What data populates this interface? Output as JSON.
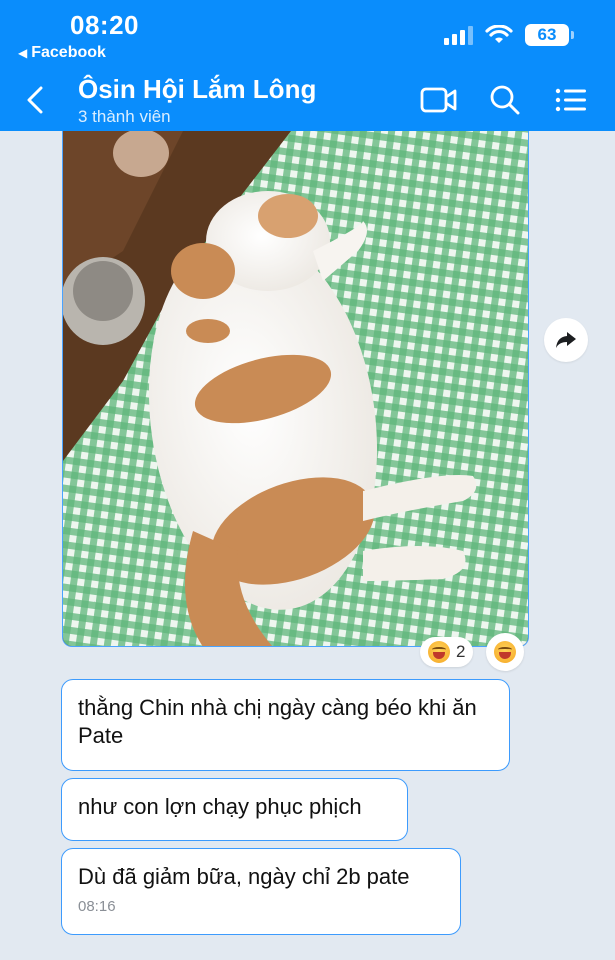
{
  "status_bar": {
    "time": "08:20",
    "back_app": "Facebook",
    "battery": "63"
  },
  "header": {
    "title": "Ôsin Hội Lắm Lông",
    "subtitle": "3 thành viên"
  },
  "photo": {
    "reaction_count": "2"
  },
  "messages": [
    {
      "text": "thằng Chin nhà chị ngày càng béo khi ăn Pate"
    },
    {
      "text": "như con lợn chạy phục phịch"
    },
    {
      "text": "Dù đã giảm bữa, ngày chỉ 2b pate",
      "time": "08:16"
    }
  ],
  "icons": [
    "back-arrow-icon",
    "video-call-icon",
    "search-icon",
    "menu-list-icon",
    "share-arrow-icon",
    "laugh-emoji-icon"
  ]
}
